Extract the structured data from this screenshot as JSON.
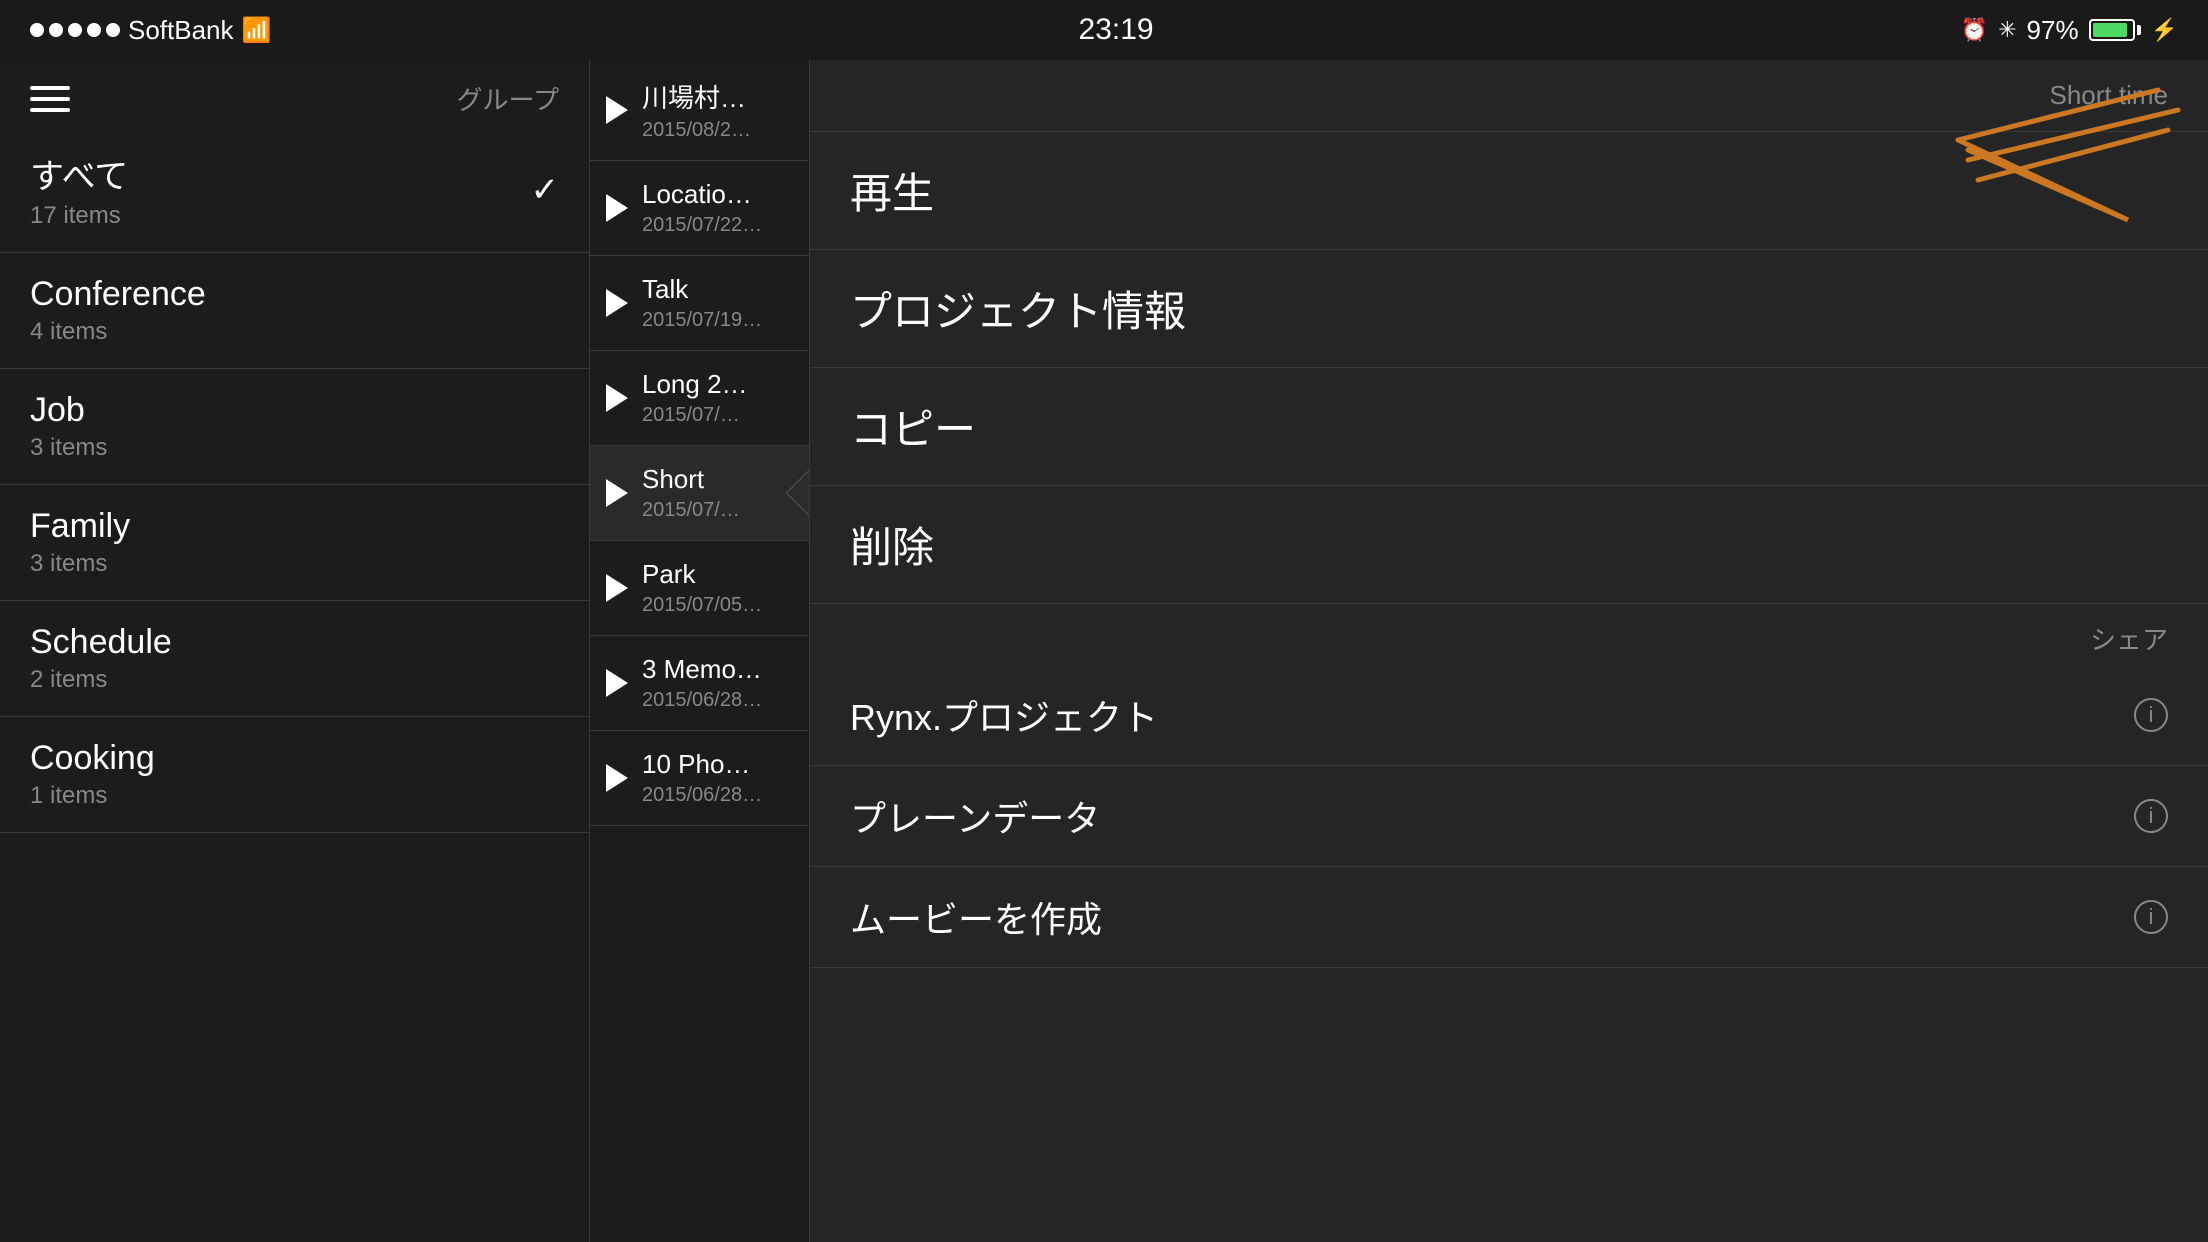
{
  "status_bar": {
    "carrier": "SoftBank",
    "time": "23:19",
    "battery_percent": "97%",
    "dots_count": 5
  },
  "left_panel": {
    "header_label": "グループ",
    "groups": [
      {
        "name": "すべて",
        "count": "17 items",
        "selected": true
      },
      {
        "name": "Conference",
        "count": "4 items",
        "selected": false
      },
      {
        "name": "Job",
        "count": "3 items",
        "selected": false
      },
      {
        "name": "Family",
        "count": "3 items",
        "selected": false
      },
      {
        "name": "Schedule",
        "count": "2 items",
        "selected": false
      },
      {
        "name": "Cooking",
        "count": "1 items",
        "selected": false
      }
    ]
  },
  "middle_panel": {
    "recordings": [
      {
        "name": "川場村…",
        "date": "2015/08/2…",
        "active": false
      },
      {
        "name": "Locatio…",
        "date": "2015/07/22…",
        "active": false
      },
      {
        "name": "Talk",
        "date": "2015/07/19…",
        "active": false
      },
      {
        "name": "Long 2…",
        "date": "2015/07/…",
        "active": false
      },
      {
        "name": "Short",
        "date": "2015/07/…",
        "active": true
      },
      {
        "name": "Park",
        "date": "2015/07/05…",
        "active": false
      },
      {
        "name": "3 Memo…",
        "date": "2015/06/28…",
        "active": false
      },
      {
        "name": "10 Pho…",
        "date": "2015/06/28…",
        "active": false
      }
    ]
  },
  "right_panel": {
    "short_time_label": "Short time",
    "menu_items": [
      {
        "label": "再生",
        "type": "plain"
      },
      {
        "label": "プロジェクト情報",
        "type": "plain"
      },
      {
        "label": "コピー",
        "type": "plain"
      },
      {
        "label": "削除",
        "type": "plain"
      }
    ],
    "share_label": "シェア",
    "share_items": [
      {
        "label": "Rynx.プロジェクト",
        "has_info": true
      },
      {
        "label": "プレーンデータ",
        "has_info": true
      },
      {
        "label": "ムービーを作成",
        "has_info": true
      }
    ]
  },
  "icons": {
    "hamburger": "≡",
    "play": "▶",
    "checkmark": "✓",
    "info": "ⓘ"
  }
}
